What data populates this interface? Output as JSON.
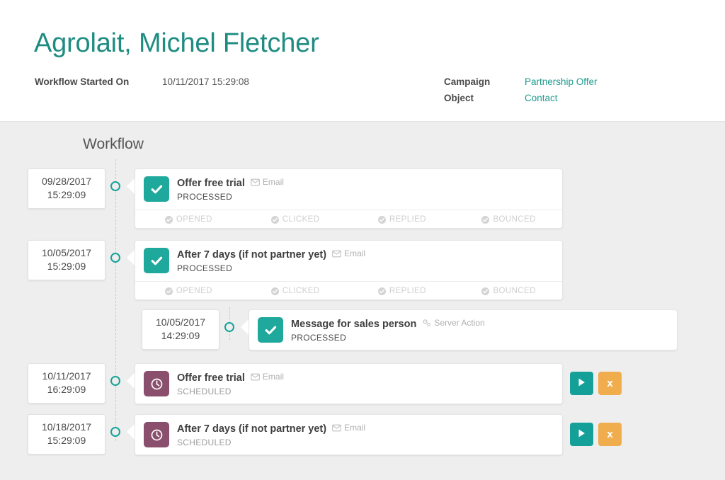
{
  "header": {
    "title": "Agrolait, Michel Fletcher",
    "started_label": "Workflow Started On",
    "started_value": "10/11/2017 15:29:08",
    "campaign_label": "Campaign",
    "campaign_value": "Partnership Offer",
    "object_label": "Object",
    "object_value": "Contact"
  },
  "timeline": {
    "heading": "Workflow",
    "stat_labels": [
      "OPENED",
      "CLICKED",
      "REPLIED",
      "BOUNCED"
    ],
    "rows": [
      {
        "date": "09/28/2017",
        "time": "15:29:09",
        "title": "Offer free trial",
        "type": "Email",
        "type_icon": "envelope-icon",
        "state": "done",
        "state_icon": "check-icon",
        "status": "PROCESSED",
        "has_stats": true,
        "has_actions": false
      },
      {
        "date": "10/05/2017",
        "time": "15:29:09",
        "title": "After 7 days (if not partner yet)",
        "type": "Email",
        "type_icon": "envelope-icon",
        "state": "done",
        "state_icon": "check-icon",
        "status": "PROCESSED",
        "has_stats": true,
        "has_actions": false
      },
      {
        "date": "10/05/2017",
        "time": "14:29:09",
        "title": "Message for sales person",
        "type": "Server Action",
        "type_icon": "cogs-icon",
        "state": "done",
        "state_icon": "check-icon",
        "status": "PROCESSED",
        "has_stats": false,
        "has_actions": false
      },
      {
        "date": "10/11/2017",
        "time": "16:29:09",
        "title": "Offer free trial",
        "type": "Email",
        "type_icon": "envelope-icon",
        "state": "scheduled",
        "state_icon": "clock-icon",
        "status": "SCHEDULED",
        "has_stats": false,
        "has_actions": true
      },
      {
        "date": "10/18/2017",
        "time": "15:29:09",
        "title": "After 7 days (if not partner yet)",
        "type": "Email",
        "type_icon": "envelope-icon",
        "state": "scheduled",
        "state_icon": "clock-icon",
        "status": "SCHEDULED",
        "has_stats": false,
        "has_actions": true
      }
    ],
    "actions": {
      "play_label": "play-now",
      "cancel_label": "x"
    }
  },
  "colors": {
    "teal": "#1f8c82",
    "teal_accent": "#1fa89c",
    "purple": "#8a4f6d",
    "orange": "#f0ad4e",
    "background": "#eeeeee"
  }
}
